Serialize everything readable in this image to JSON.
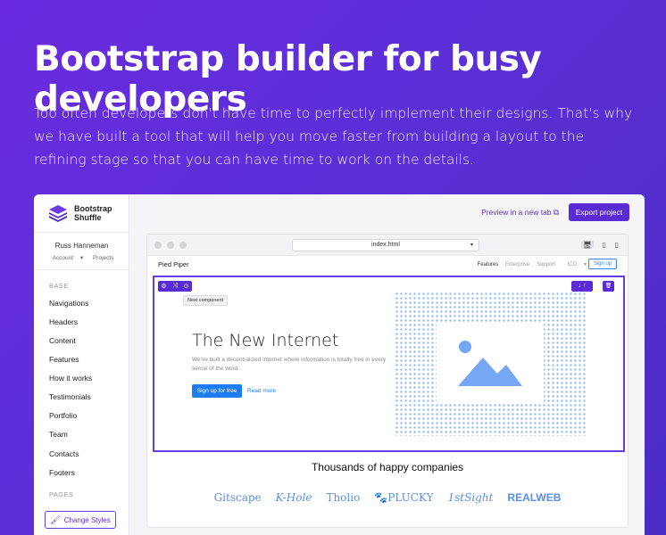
{
  "hero": {
    "title": "Bootstrap builder for busy developers",
    "description": "Too often developers don't have time to perfectly implement their designs. That's why we have built a tool that will help you move faster from building a layout to the refining stage so that you can have time to work on the details."
  },
  "sidebar": {
    "brand_line1": "Bootstrap",
    "brand_line2": "Shuffle",
    "user_name": "Russ Hanneman",
    "account_label": "Account",
    "projects_label": "Projects",
    "base_label": "BASE",
    "items": [
      "Navigations",
      "Headers",
      "Content",
      "Features",
      "How it works",
      "Testimonials",
      "Portfolio",
      "Team",
      "Contacts",
      "Footers"
    ],
    "pages_label": "PAGES",
    "change_styles_label": "Change Styles"
  },
  "toolbar": {
    "preview_label": "Preview in a new tab",
    "export_label": "Export project"
  },
  "browser": {
    "url": "index.html"
  },
  "site": {
    "brand": "Pied Piper",
    "nav_links": [
      "Features",
      "Enterprise",
      "Support",
      "ICO"
    ],
    "signup_label": "Sign up"
  },
  "component": {
    "tooltip": "Next component",
    "heading": "The New Internet",
    "text": "We've built a decentralized internet where information is totally free in every sense of the word.",
    "signup_label": "Sign up for free",
    "read_more_label": "Read more"
  },
  "companies": {
    "title": "Thousands of happy companies",
    "logos": [
      "Gitscape",
      "K-Hole",
      "Tholio",
      "PLUCKY",
      "1stSight",
      "REALWEB"
    ]
  },
  "colors": {
    "accent": "#5a2bd4",
    "link_blue": "#1d7cf2",
    "logo_blue": "#5b8fe0"
  }
}
